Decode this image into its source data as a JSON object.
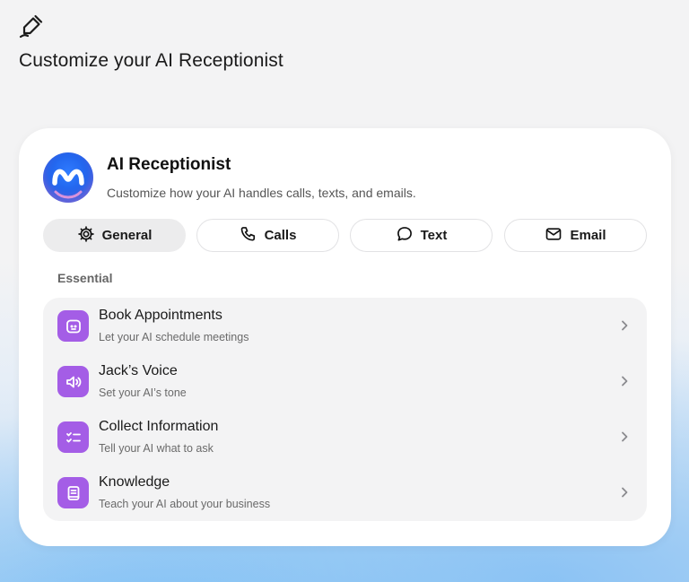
{
  "page": {
    "title": "Customize your AI Receptionist",
    "edit_icon": "pen-edit-icon"
  },
  "card": {
    "title": "AI Receptionist",
    "subtitle": "Customize how your AI handles calls, texts, and emails.",
    "avatar_icon": "brand-logo-icon"
  },
  "tabs": [
    {
      "label": "General",
      "icon": "gear-icon",
      "active": true
    },
    {
      "label": "Calls",
      "icon": "phone-icon",
      "active": false
    },
    {
      "label": "Text",
      "icon": "chat-bubble-icon",
      "active": false
    },
    {
      "label": "Email",
      "icon": "envelope-icon",
      "active": false
    }
  ],
  "section": {
    "label": "Essential"
  },
  "items": [
    {
      "title": "Book Appointments",
      "subtitle": "Let your AI schedule meetings",
      "icon": "calendar-icon"
    },
    {
      "title": "Jack’s Voice",
      "subtitle": "Set your AI’s tone",
      "icon": "speaker-icon"
    },
    {
      "title": "Collect Information",
      "subtitle": "Tell your AI what to ask",
      "icon": "checklist-icon"
    },
    {
      "title": "Knowledge",
      "subtitle": "Teach your AI about your business",
      "icon": "book-icon"
    }
  ],
  "colors": {
    "accent": "#a45de6",
    "brand_blue": "#1d5fe8",
    "active_tab_bg": "#ececed"
  }
}
